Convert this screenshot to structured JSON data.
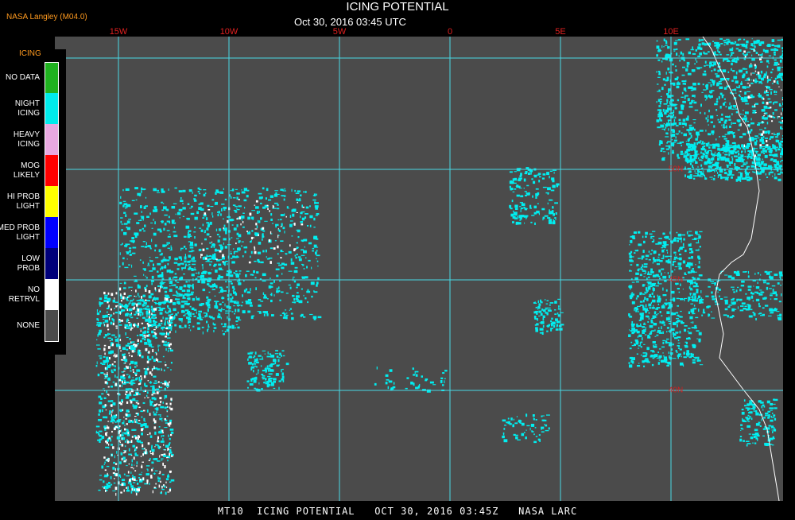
{
  "header": {
    "credit": "NASA Langley (M04.0)",
    "title": "ICING POTENTIAL",
    "datetime": "Oct 30, 2016 03:45 UTC"
  },
  "footer": {
    "text": "MT10  ICING POTENTIAL   OCT 30, 2016 03:45Z   NASA LARC"
  },
  "map": {
    "background_color": "#4b4b4b",
    "grid_color": "#48d8e6",
    "coast_color": "#ffffff",
    "lon_ticks": [
      {
        "label": "15W",
        "lon": -15
      },
      {
        "label": "10W",
        "lon": -10
      },
      {
        "label": "5W",
        "lon": -5
      },
      {
        "label": "0",
        "lon": 0
      },
      {
        "label": "5E",
        "lon": 5
      },
      {
        "label": "10E",
        "lon": 10
      }
    ],
    "lat_ticks": [
      {
        "label": "50N",
        "lat": 50
      },
      {
        "label": "45N",
        "lat": 45
      },
      {
        "label": "40N",
        "lat": 40
      }
    ]
  },
  "legend": {
    "heading": "ICING",
    "items": [
      {
        "label": "NO DATA",
        "color": "#1fb21f"
      },
      {
        "label": "NIGHT\nICING",
        "color": "#00ebeb"
      },
      {
        "label": "HEAVY\nICING",
        "color": "#e8a8e0"
      },
      {
        "label": "MOG\nLIKELY",
        "color": "#ff0000"
      },
      {
        "label": "HI PROB\nLIGHT",
        "color": "#ffff00"
      },
      {
        "label": "MED PROB\nLIGHT",
        "color": "#0000ff"
      },
      {
        "label": "LOW\nPROB",
        "color": "#00007a"
      },
      {
        "label": "NO\nRETRVL",
        "color": "#ffffff"
      },
      {
        "label": "NONE",
        "color": "#4b4b4b"
      }
    ]
  },
  "chart_data": {
    "type": "map",
    "lon_range": [
      -18,
      15
    ],
    "lat_range": [
      38,
      55
    ],
    "icing_areas": [
      {
        "category": "NIGHT ICING",
        "lon": [
          10,
          14
        ],
        "lat": [
          51,
          54
        ]
      },
      {
        "category": "NIGHT ICING",
        "lon": [
          8,
          11
        ],
        "lat": [
          49,
          51
        ]
      },
      {
        "category": "NIGHT ICING",
        "lon": [
          -14,
          -7
        ],
        "lat": [
          43,
          48
        ]
      },
      {
        "category": "NIGHT ICING",
        "lon": [
          7,
          12
        ],
        "lat": [
          41,
          47
        ]
      },
      {
        "category": "NIGHT ICING",
        "lon": [
          2,
          5
        ],
        "lat": [
          47,
          49.5
        ]
      },
      {
        "category": "NIGHT ICING",
        "lon": [
          -17,
          -13
        ],
        "lat": [
          37.5,
          42.5
        ]
      },
      {
        "category": "NO RETRVL",
        "lon": [
          -16,
          -13
        ],
        "lat": [
          38,
          45
        ]
      }
    ]
  }
}
